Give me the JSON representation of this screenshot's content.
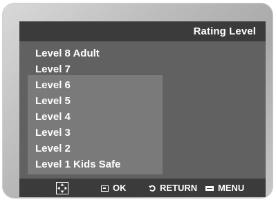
{
  "screen": {
    "title": "Rating Level"
  },
  "levels": [
    "Level 8 Adult",
    "Level 7",
    "Level 6",
    "Level 5",
    "Level 4",
    "Level 3",
    "Level 2",
    "Level 1 Kids Safe"
  ],
  "footer": {
    "nav_icon": "directional-pad-icon",
    "ok_icon": "enter-icon",
    "ok_label": "OK",
    "return_icon": "return-arrow-icon",
    "return_label": "RETURN",
    "menu_icon": "menu-icon",
    "menu_label": "MENU"
  },
  "colors": {
    "panel_bg": "#616161",
    "bar_bg": "#3b3b3b",
    "selection_bg": "#7a7a7a",
    "text": "#ffffff"
  }
}
